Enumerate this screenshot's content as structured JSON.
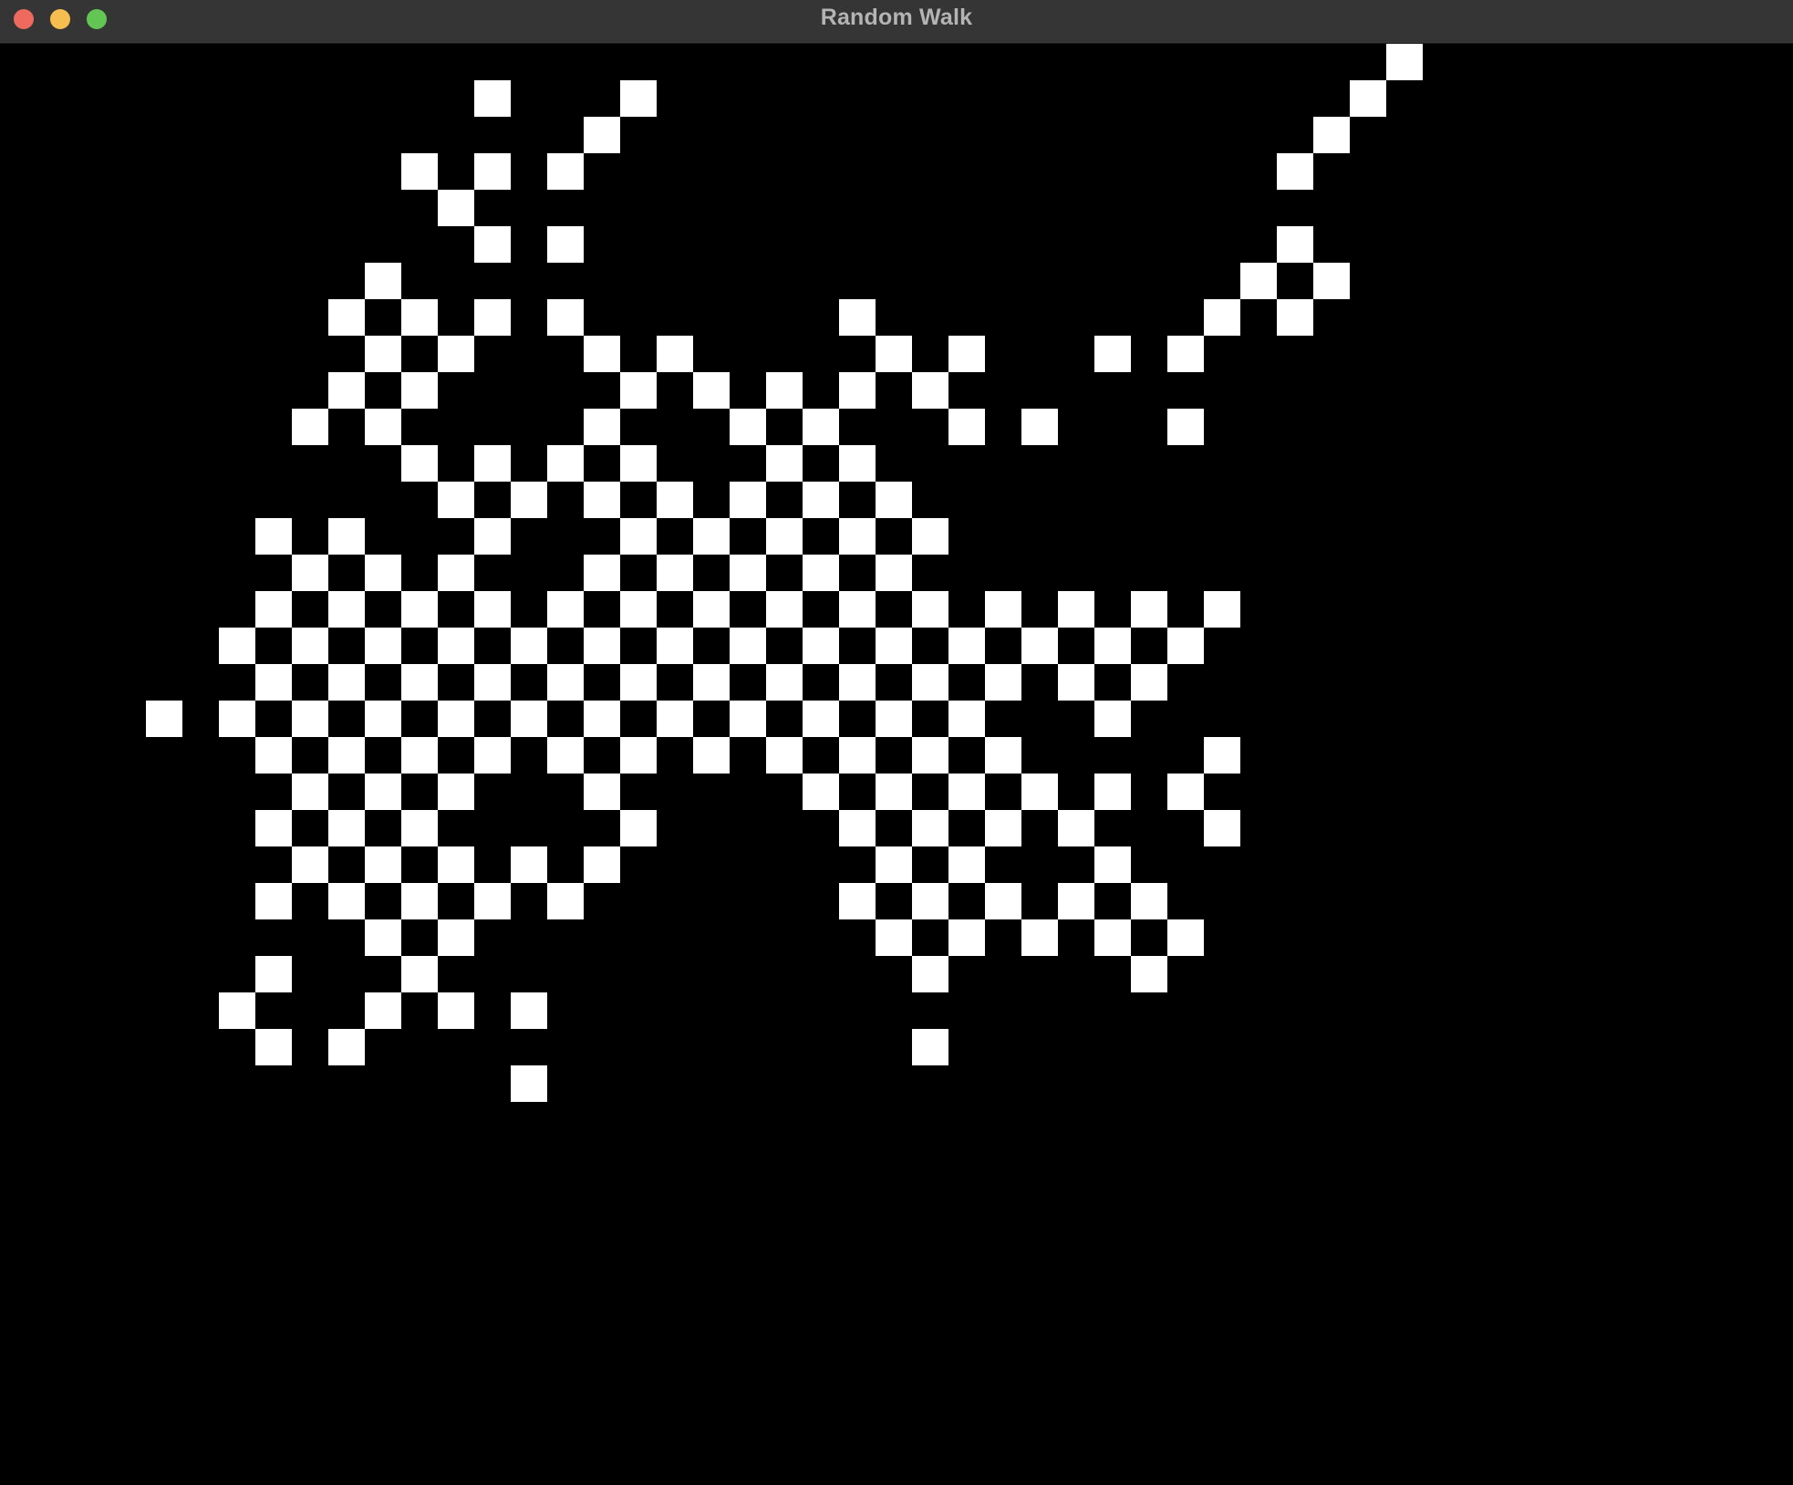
{
  "window": {
    "title": "Random Walk"
  },
  "colors": {
    "titlebar": "#353535",
    "title_text": "#b4b4b4",
    "close": "#ee6a5f",
    "minimize": "#f5be4f",
    "maximize": "#62c554",
    "background": "#000000",
    "visited": "#ffffff"
  },
  "grid": {
    "visited_cells": [
      [
        38,
        0
      ],
      [
        13,
        1
      ],
      [
        17,
        1
      ],
      [
        37,
        1
      ],
      [
        16,
        2
      ],
      [
        36,
        2
      ],
      [
        11,
        3
      ],
      [
        13,
        3
      ],
      [
        15,
        3
      ],
      [
        35,
        3
      ],
      [
        12,
        4
      ],
      [
        13,
        5
      ],
      [
        15,
        5
      ],
      [
        35,
        5
      ],
      [
        10,
        6
      ],
      [
        34,
        6
      ],
      [
        36,
        6
      ],
      [
        9,
        7
      ],
      [
        11,
        7
      ],
      [
        13,
        7
      ],
      [
        15,
        7
      ],
      [
        23,
        7
      ],
      [
        33,
        7
      ],
      [
        35,
        7
      ],
      [
        10,
        8
      ],
      [
        12,
        8
      ],
      [
        16,
        8
      ],
      [
        18,
        8
      ],
      [
        24,
        8
      ],
      [
        26,
        8
      ],
      [
        30,
        8
      ],
      [
        32,
        8
      ],
      [
        9,
        9
      ],
      [
        11,
        9
      ],
      [
        17,
        9
      ],
      [
        19,
        9
      ],
      [
        21,
        9
      ],
      [
        23,
        9
      ],
      [
        25,
        9
      ],
      [
        8,
        10
      ],
      [
        10,
        10
      ],
      [
        16,
        10
      ],
      [
        20,
        10
      ],
      [
        22,
        10
      ],
      [
        26,
        10
      ],
      [
        28,
        10
      ],
      [
        32,
        10
      ],
      [
        11,
        11
      ],
      [
        13,
        11
      ],
      [
        15,
        11
      ],
      [
        17,
        11
      ],
      [
        21,
        11
      ],
      [
        23,
        11
      ],
      [
        12,
        12
      ],
      [
        14,
        12
      ],
      [
        16,
        12
      ],
      [
        18,
        12
      ],
      [
        20,
        12
      ],
      [
        22,
        12
      ],
      [
        24,
        12
      ],
      [
        7,
        13
      ],
      [
        9,
        13
      ],
      [
        13,
        13
      ],
      [
        17,
        13
      ],
      [
        19,
        13
      ],
      [
        21,
        13
      ],
      [
        23,
        13
      ],
      [
        25,
        13
      ],
      [
        8,
        14
      ],
      [
        10,
        14
      ],
      [
        12,
        14
      ],
      [
        16,
        14
      ],
      [
        18,
        14
      ],
      [
        20,
        14
      ],
      [
        22,
        14
      ],
      [
        24,
        14
      ],
      [
        7,
        15
      ],
      [
        9,
        15
      ],
      [
        11,
        15
      ],
      [
        13,
        15
      ],
      [
        15,
        15
      ],
      [
        17,
        15
      ],
      [
        19,
        15
      ],
      [
        21,
        15
      ],
      [
        23,
        15
      ],
      [
        25,
        15
      ],
      [
        27,
        15
      ],
      [
        29,
        15
      ],
      [
        31,
        15
      ],
      [
        33,
        15
      ],
      [
        6,
        16
      ],
      [
        8,
        16
      ],
      [
        10,
        16
      ],
      [
        12,
        16
      ],
      [
        14,
        16
      ],
      [
        16,
        16
      ],
      [
        18,
        16
      ],
      [
        20,
        16
      ],
      [
        22,
        16
      ],
      [
        24,
        16
      ],
      [
        26,
        16
      ],
      [
        28,
        16
      ],
      [
        30,
        16
      ],
      [
        32,
        16
      ],
      [
        7,
        17
      ],
      [
        9,
        17
      ],
      [
        11,
        17
      ],
      [
        13,
        17
      ],
      [
        15,
        17
      ],
      [
        17,
        17
      ],
      [
        19,
        17
      ],
      [
        21,
        17
      ],
      [
        23,
        17
      ],
      [
        25,
        17
      ],
      [
        27,
        17
      ],
      [
        29,
        17
      ],
      [
        31,
        17
      ],
      [
        4,
        18
      ],
      [
        6,
        18
      ],
      [
        8,
        18
      ],
      [
        10,
        18
      ],
      [
        12,
        18
      ],
      [
        14,
        18
      ],
      [
        16,
        18
      ],
      [
        18,
        18
      ],
      [
        20,
        18
      ],
      [
        22,
        18
      ],
      [
        24,
        18
      ],
      [
        26,
        18
      ],
      [
        30,
        18
      ],
      [
        7,
        19
      ],
      [
        9,
        19
      ],
      [
        11,
        19
      ],
      [
        13,
        19
      ],
      [
        15,
        19
      ],
      [
        17,
        19
      ],
      [
        19,
        19
      ],
      [
        21,
        19
      ],
      [
        23,
        19
      ],
      [
        25,
        19
      ],
      [
        27,
        19
      ],
      [
        33,
        19
      ],
      [
        8,
        20
      ],
      [
        10,
        20
      ],
      [
        12,
        20
      ],
      [
        16,
        20
      ],
      [
        22,
        20
      ],
      [
        24,
        20
      ],
      [
        26,
        20
      ],
      [
        28,
        20
      ],
      [
        30,
        20
      ],
      [
        32,
        20
      ],
      [
        7,
        21
      ],
      [
        9,
        21
      ],
      [
        11,
        21
      ],
      [
        17,
        21
      ],
      [
        23,
        21
      ],
      [
        25,
        21
      ],
      [
        27,
        21
      ],
      [
        29,
        21
      ],
      [
        33,
        21
      ],
      [
        8,
        22
      ],
      [
        10,
        22
      ],
      [
        12,
        22
      ],
      [
        14,
        22
      ],
      [
        16,
        22
      ],
      [
        24,
        22
      ],
      [
        26,
        22
      ],
      [
        30,
        22
      ],
      [
        7,
        23
      ],
      [
        9,
        23
      ],
      [
        11,
        23
      ],
      [
        13,
        23
      ],
      [
        15,
        23
      ],
      [
        23,
        23
      ],
      [
        25,
        23
      ],
      [
        27,
        23
      ],
      [
        29,
        23
      ],
      [
        31,
        23
      ],
      [
        10,
        24
      ],
      [
        12,
        24
      ],
      [
        24,
        24
      ],
      [
        26,
        24
      ],
      [
        28,
        24
      ],
      [
        30,
        24
      ],
      [
        32,
        24
      ],
      [
        7,
        25
      ],
      [
        11,
        25
      ],
      [
        25,
        25
      ],
      [
        31,
        25
      ],
      [
        6,
        26
      ],
      [
        10,
        26
      ],
      [
        12,
        26
      ],
      [
        14,
        26
      ],
      [
        7,
        27
      ],
      [
        9,
        27
      ],
      [
        25,
        27
      ],
      [
        14,
        28
      ]
    ]
  }
}
